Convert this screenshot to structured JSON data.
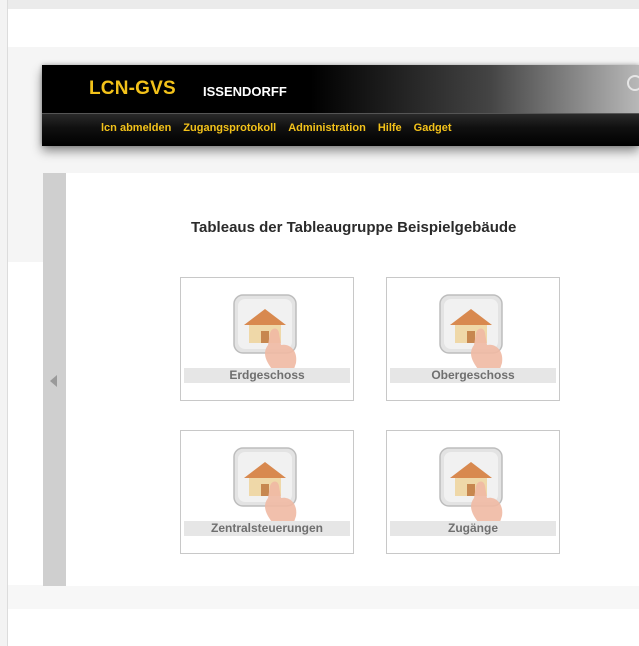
{
  "header": {
    "brand": "LCN-GVS",
    "site": "ISSENDORFF"
  },
  "nav": {
    "items": [
      {
        "label": "lcn abmelden"
      },
      {
        "label": "Zugangsprotokoll"
      },
      {
        "label": "Administration"
      },
      {
        "label": "Hilfe"
      },
      {
        "label": "Gadget"
      }
    ]
  },
  "main": {
    "title": "Tableaus der Tableaugruppe Beispielgebäude",
    "tiles": [
      {
        "label": "Erdgeschoss",
        "icon": "house-hand-icon"
      },
      {
        "label": "Obergeschoss",
        "icon": "house-hand-icon"
      },
      {
        "label": "Zentralsteuerungen",
        "icon": "house-hand-icon"
      },
      {
        "label": "Zugänge",
        "icon": "house-hand-icon"
      }
    ]
  },
  "colors": {
    "brand": "#f3c21a",
    "header_bg": "#000000",
    "tile_label_bg": "#e6e6e6"
  }
}
